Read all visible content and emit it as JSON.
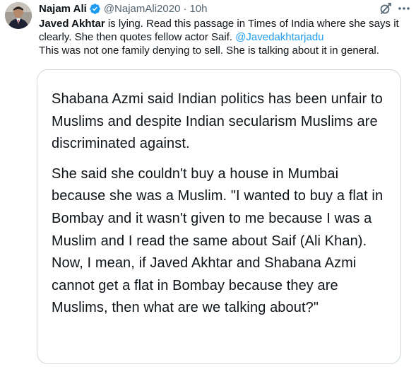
{
  "tweet": {
    "author_name": "Najam Ali",
    "handle": "@NajamAli2020",
    "separator": "·",
    "time": "10h",
    "body": {
      "mention_name": "Javed Akhtar",
      "text_part1": " is lying. Read this passage in Times of India where she says it clearly. She then quotes fellow actor Saif. ",
      "mention_handle": "@Javedakhtarjadu",
      "text_part2": "This was not one family denying to sell. She is talking about it in general."
    },
    "quote": {
      "paragraph1": "Shabana Azmi said Indian politics has been unfair to Muslims and despite Indian secularism Muslims are discriminated against.",
      "paragraph2": "She said she couldn't buy a house in Mumbai because she was a Muslim. \"I wanted to buy a flat in Bombay and it wasn't given to me because I was a Muslim and I read the same about Saif (Ali Khan). Now, I mean, if Javed Akhtar and Shabana Azmi cannot get a flat in Bombay because they are Muslims, then what are we talking about?\""
    }
  },
  "icons": {
    "verified": "verified-badge-icon",
    "grok": "grok-icon",
    "more": "more-options-icon",
    "avatar": "profile-avatar"
  },
  "colors": {
    "text": "#0f1419",
    "secondary": "#536471",
    "link": "#1d9bf0",
    "verified": "#1d9bf0",
    "border": "#cfd9de"
  }
}
